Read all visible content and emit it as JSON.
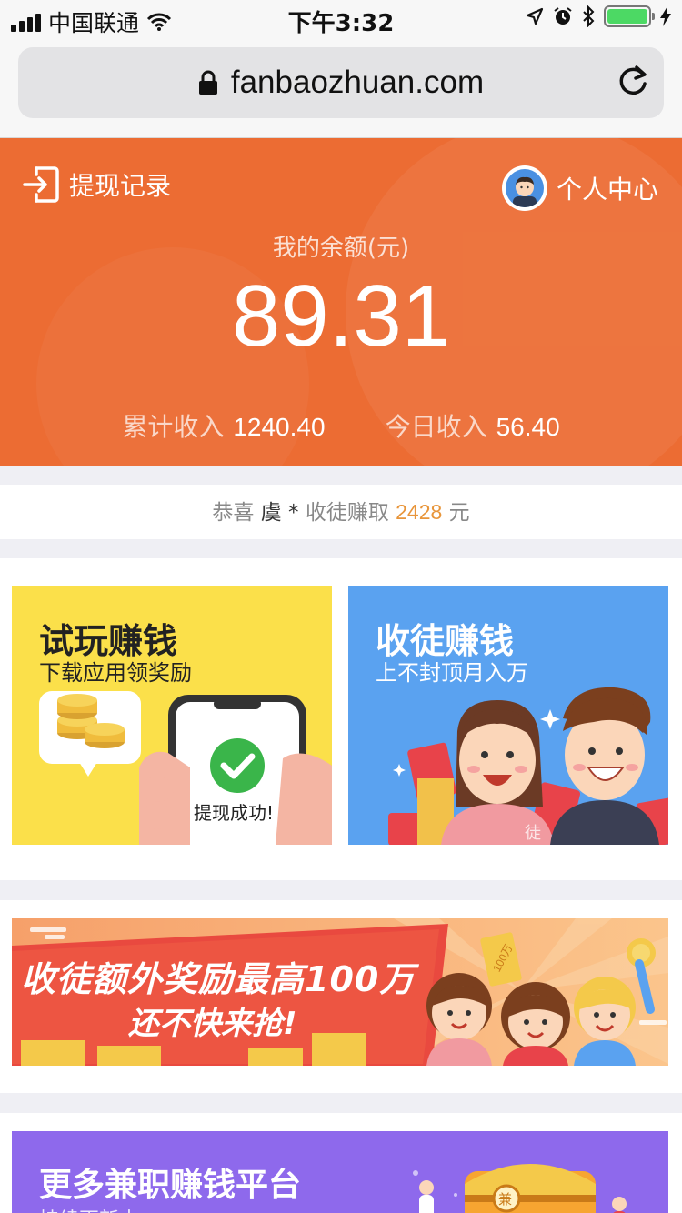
{
  "status_bar": {
    "carrier": "中国联通",
    "time": "下午3:32"
  },
  "browser": {
    "url": "fanbaozhuan.com"
  },
  "header": {
    "withdraw_records": "提现记录",
    "profile": "个人中心",
    "balance_label": "我的余额(元)",
    "balance": "89.31",
    "total_income_label": "累计收入",
    "total_income": "1240.40",
    "today_income_label": "今日收入",
    "today_income": "56.40"
  },
  "notice": {
    "prefix": "恭喜",
    "name": "虞 *",
    "middle": "收徒赚取",
    "amount": "2428",
    "suffix": "元"
  },
  "cards": [
    {
      "title": "试玩赚钱",
      "subtitle": "下载应用领奖励",
      "phone_text": "提现成功!"
    },
    {
      "title": "收徒赚钱",
      "subtitle": "上不封顶月入万",
      "badge": "徒"
    }
  ],
  "banner": {
    "line1": "收徒额外奖励最高100万",
    "line2": "还不快来抢!",
    "ticket": "100万"
  },
  "more": {
    "title": "更多兼职赚钱平台",
    "subtitle": "持续更新中",
    "chest_label": "兼"
  },
  "colors": {
    "accent": "#ec6c33",
    "highlight": "#e8953a",
    "yellow_card": "#fbe04a",
    "blue_card": "#5aa2f0",
    "purple_card": "#8e69ec"
  }
}
